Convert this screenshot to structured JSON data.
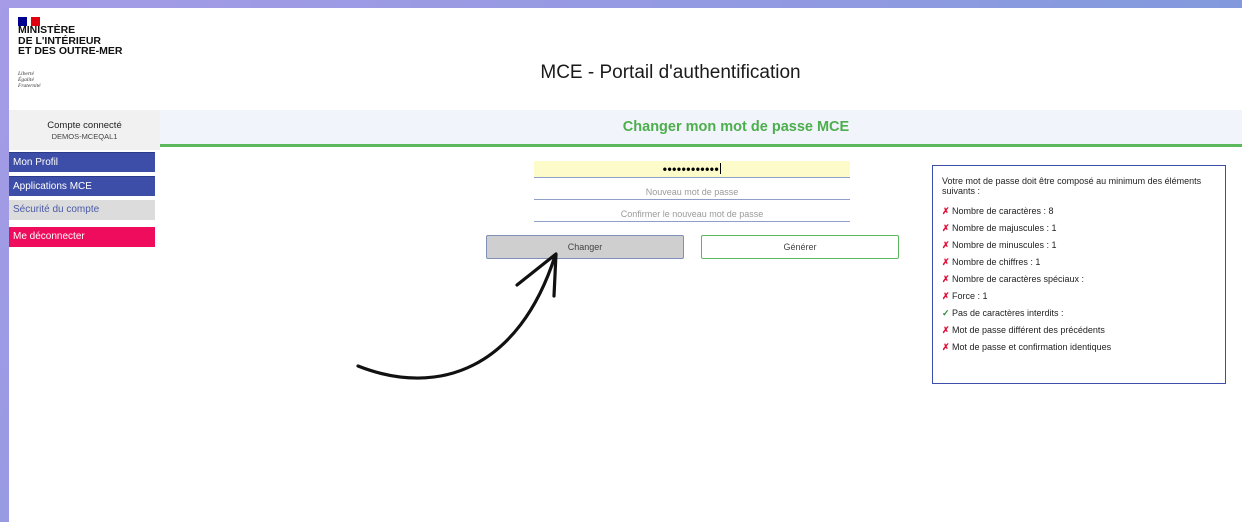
{
  "header": {
    "ministry_lines": [
      "MINISTÈRE",
      "DE L'INTÉRIEUR",
      "ET DES OUTRE-MER"
    ],
    "motto_lines": [
      "Liberté",
      "Égalité",
      "Fraternité"
    ],
    "title": "MCE - Portail d'authentification",
    "flag_colors": [
      "#000091",
      "#ffffff",
      "#e1000f"
    ]
  },
  "account": {
    "label": "Compte connecté",
    "username": "DEMOS-MCEQAL1"
  },
  "banner": {
    "title": "Changer mon mot de passe MCE"
  },
  "sidebar": {
    "items": [
      {
        "label": "Mon Profil"
      },
      {
        "label": "Applications MCE"
      },
      {
        "label": "Sécurité du compte"
      },
      {
        "label": "Me déconnecter"
      }
    ]
  },
  "form": {
    "current_password_masked": "••••••••••••",
    "new_password_placeholder": "Nouveau mot de passe",
    "confirm_password_placeholder": "Confirmer le nouveau mot de passe",
    "change_label": "Changer",
    "generate_label": "Générer"
  },
  "rules": {
    "intro": "Votre mot de passe doit être composé au minimum des éléments suivants :",
    "items": [
      {
        "status": "fail",
        "mark": "✗",
        "text": "Nombre de caractères : 8"
      },
      {
        "status": "fail",
        "mark": "✗",
        "text": "Nombre de majuscules : 1"
      },
      {
        "status": "fail",
        "mark": "✗",
        "text": "Nombre de minuscules : 1"
      },
      {
        "status": "fail",
        "mark": "✗",
        "text": "Nombre de chiffres : 1"
      },
      {
        "status": "fail",
        "mark": "✗",
        "text": "Nombre de caractères spéciaux :"
      },
      {
        "status": "fail",
        "mark": "✗",
        "text": "Force : 1"
      },
      {
        "status": "ok",
        "mark": "✓",
        "text": "Pas de caractères interdits :"
      },
      {
        "status": "fail",
        "mark": "✗",
        "text": "Mot de passe différent des précédents"
      },
      {
        "status": "fail",
        "mark": "✗",
        "text": "Mot de passe et confirmation identiques"
      }
    ]
  },
  "colors": {
    "accent_green": "#4cae4c",
    "nav_blue": "#3c4ea7",
    "logout_red": "#ef0c5c",
    "fail_red": "#e0103a",
    "ok_green": "#2e8b3a"
  }
}
